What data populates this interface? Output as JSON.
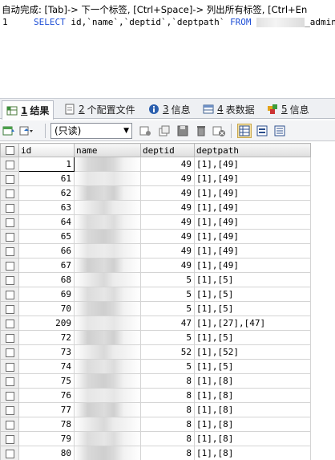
{
  "editor": {
    "hint": "自动完成: [Tab]-> 下一个标签, [Ctrl+Space]-> 列出所有标签, [Ctrl+En",
    "line_number": "1",
    "sql_select": "SELECT",
    "sql_columns": " id,`name`,`deptid`,`deptpath` ",
    "sql_from": "FROM",
    "sql_table_suffix": "_admin"
  },
  "tabs": [
    {
      "num": "1",
      "label": "结果",
      "icon": "grid-icon"
    },
    {
      "num": "2",
      "label": "个配置文件",
      "icon": "profile-icon"
    },
    {
      "num": "3",
      "label": "信息",
      "icon": "info-icon"
    },
    {
      "num": "4",
      "label": "表数据",
      "icon": "table-data-icon"
    },
    {
      "num": "5",
      "label": "信息",
      "icon": "info-icon-2"
    }
  ],
  "toolbar": {
    "mode_select": "(只读)"
  },
  "grid": {
    "columns": [
      "id",
      "name",
      "deptid",
      "deptpath"
    ],
    "rows": [
      {
        "id": "1",
        "deptid": "49",
        "deptpath": "[1],[49]"
      },
      {
        "id": "61",
        "deptid": "49",
        "deptpath": "[1],[49]"
      },
      {
        "id": "62",
        "deptid": "49",
        "deptpath": "[1],[49]"
      },
      {
        "id": "63",
        "deptid": "49",
        "deptpath": "[1],[49]"
      },
      {
        "id": "64",
        "deptid": "49",
        "deptpath": "[1],[49]"
      },
      {
        "id": "65",
        "deptid": "49",
        "deptpath": "[1],[49]"
      },
      {
        "id": "66",
        "deptid": "49",
        "deptpath": "[1],[49]"
      },
      {
        "id": "67",
        "deptid": "49",
        "deptpath": "[1],[49]"
      },
      {
        "id": "68",
        "deptid": "5",
        "deptpath": "[1],[5]"
      },
      {
        "id": "69",
        "deptid": "5",
        "deptpath": "[1],[5]"
      },
      {
        "id": "70",
        "deptid": "5",
        "deptpath": "[1],[5]"
      },
      {
        "id": "209",
        "deptid": "47",
        "deptpath": "[1],[27],[47]"
      },
      {
        "id": "72",
        "deptid": "5",
        "deptpath": "[1],[5]"
      },
      {
        "id": "73",
        "deptid": "52",
        "deptpath": "[1],[52]"
      },
      {
        "id": "74",
        "deptid": "5",
        "deptpath": "[1],[5]"
      },
      {
        "id": "75",
        "deptid": "8",
        "deptpath": "[1],[8]"
      },
      {
        "id": "76",
        "deptid": "8",
        "deptpath": "[1],[8]"
      },
      {
        "id": "77",
        "deptid": "8",
        "deptpath": "[1],[8]"
      },
      {
        "id": "78",
        "deptid": "8",
        "deptpath": "[1],[8]"
      },
      {
        "id": "79",
        "deptid": "8",
        "deptpath": "[1],[8]"
      },
      {
        "id": "80",
        "deptid": "8",
        "deptpath": "[1],[8]"
      }
    ]
  },
  "colors": {
    "keyword": "#1f4fd6",
    "tab_bar": "#eef0f3",
    "header": "#dedede"
  }
}
